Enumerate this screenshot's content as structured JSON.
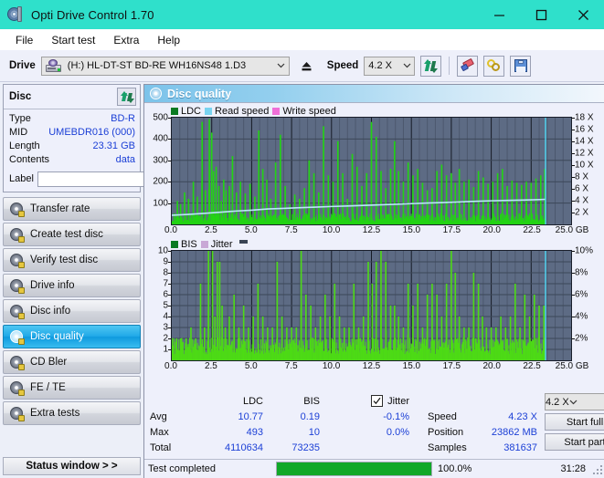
{
  "window": {
    "title": "Opti Drive Control 1.70",
    "icon": "disc-icon",
    "minimize": "–",
    "maximize": "□",
    "close": "✕"
  },
  "menu": {
    "items": [
      "File",
      "Start test",
      "Extra",
      "Help"
    ]
  },
  "toolbar": {
    "drive_label": "Drive",
    "drive_value": "(H:)   HL-DT-ST BD-RE  WH16NS48 1.D3",
    "eject_icon": "eject-icon",
    "speed_label": "Speed",
    "speed_value": "4.2 X",
    "refresh_icon": "refresh-icon",
    "eraser_icon": "eraser-icon",
    "chain_icon": "chain-icon",
    "save_icon": "save-icon"
  },
  "disc_panel": {
    "title": "Disc",
    "refresh_icon": "refresh-icon",
    "rows": [
      {
        "key": "Type",
        "value": "BD-R"
      },
      {
        "key": "MID",
        "value": "UMEBDR016 (000)"
      },
      {
        "key": "Length",
        "value": "23.31 GB"
      },
      {
        "key": "Contents",
        "value": "data"
      }
    ],
    "label_key": "Label",
    "label_value": "",
    "label_placeholder": "",
    "disc_icon": "yellow-disc-icon"
  },
  "nav": {
    "items": [
      {
        "label": "Transfer rate",
        "active": false
      },
      {
        "label": "Create test disc",
        "active": false
      },
      {
        "label": "Verify test disc",
        "active": false
      },
      {
        "label": "Drive info",
        "active": false
      },
      {
        "label": "Disc info",
        "active": false
      },
      {
        "label": "Disc quality",
        "active": true
      },
      {
        "label": "CD Bler",
        "active": false
      },
      {
        "label": "FE / TE",
        "active": false
      },
      {
        "label": "Extra tests",
        "active": false
      }
    ],
    "status_window": "Status window > >"
  },
  "content": {
    "title": "Disc quality",
    "icon": "disc-quality-icon"
  },
  "chart_data": [
    {
      "type": "bar",
      "name": "top-chart",
      "title": "",
      "legend": [
        {
          "label": "LDC",
          "color": "#0a7a22"
        },
        {
          "label": "Read speed",
          "color": "#79d3f0"
        },
        {
          "label": "Write speed",
          "color": "#f06fd8"
        }
      ],
      "legend_position": "top-left",
      "grid": true,
      "xlabel": "GB",
      "xlim": [
        0,
        25
      ],
      "xticks": [
        0.0,
        2.5,
        5.0,
        7.5,
        10.0,
        12.5,
        15.0,
        17.5,
        20.0,
        22.5,
        25.0
      ],
      "xticklabels": [
        "0.0",
        "2.5",
        "5.0",
        "7.5",
        "10.0",
        "12.5",
        "15.0",
        "17.5",
        "20.0",
        "22.5",
        "25.0 GB"
      ],
      "ylabel": "",
      "ylim": [
        0,
        500
      ],
      "yticks": [
        100,
        200,
        300,
        400,
        500
      ],
      "yticklabels": [
        "100",
        "200",
        "300",
        "400",
        "500"
      ],
      "y2lim": [
        0,
        18
      ],
      "y2ticks": [
        2,
        4,
        6,
        8,
        10,
        12,
        14,
        16,
        18
      ],
      "y2ticklabels": [
        "2 X",
        "4 X",
        "6 X",
        "8 X",
        "10 X",
        "12 X",
        "14 X",
        "16 X",
        "18 X"
      ],
      "plot_bg": "#5d6b84",
      "data_end_gb": 23.4,
      "series": [
        {
          "name": "LDC",
          "color": "#22d413",
          "baseline": 40,
          "peaks_x": [
            0.35,
            0.55,
            0.8,
            1.05,
            1.35,
            1.6,
            1.9,
            2.1,
            2.35,
            2.5,
            2.62,
            2.78,
            2.95,
            3.1,
            3.25,
            3.4,
            3.6,
            3.8,
            4.05,
            4.3,
            4.6,
            4.9,
            5.2,
            5.45,
            5.7,
            5.95,
            6.2,
            6.5,
            6.8,
            7.1,
            7.4,
            7.7,
            8.0,
            8.3,
            8.6,
            8.9,
            9.2,
            9.5,
            9.8,
            10.1,
            10.4,
            10.7,
            11.0,
            11.3,
            11.6,
            11.9,
            12.2,
            12.5,
            12.8,
            13.1,
            13.4,
            13.7,
            13.95,
            14.2,
            14.5,
            14.8,
            15.1,
            15.4,
            15.7,
            16.0,
            16.3,
            16.6,
            16.9,
            17.2,
            17.5,
            17.75,
            18.0,
            18.3,
            18.6,
            18.9,
            19.2,
            19.5,
            19.8,
            20.1,
            20.4,
            20.7,
            21.0,
            21.3,
            21.6,
            21.9,
            22.2,
            22.5,
            22.8,
            23.1,
            23.35
          ],
          "peaks_y": [
            110,
            95,
            150,
            120,
            200,
            130,
            480,
            160,
            493,
            430,
            250,
            270,
            180,
            110,
            210,
            160,
            180,
            320,
            150,
            200,
            145,
            190,
            130,
            440,
            260,
            210,
            120,
            290,
            420,
            180,
            95,
            140,
            120,
            170,
            300,
            240,
            150,
            460,
            230,
            200,
            390,
            240,
            120,
            330,
            270,
            180,
            240,
            480,
            410,
            250,
            170,
            260,
            390,
            250,
            200,
            290,
            230,
            260,
            195,
            160,
            170,
            250,
            280,
            230,
            240,
            195,
            260,
            200,
            210,
            175,
            250,
            220,
            190,
            200,
            240,
            260,
            180,
            205,
            195,
            185,
            200,
            195,
            215,
            230,
            260
          ]
        },
        {
          "name": "Read speed",
          "color": "#b8e8f8",
          "type": "line",
          "x": [
            0.0,
            1.0,
            2.0,
            3.0,
            4.0,
            5.0,
            6.0,
            7.0,
            8.0,
            9.0,
            10.0,
            11.0,
            12.0,
            13.0,
            14.0,
            15.0,
            16.0,
            17.0,
            18.0,
            19.0,
            20.0,
            21.0,
            22.0,
            23.0,
            23.4
          ],
          "y_speed": [
            1.55,
            1.68,
            1.85,
            2.05,
            2.25,
            2.4,
            2.6,
            2.7,
            2.82,
            2.92,
            3.02,
            3.1,
            3.2,
            3.3,
            3.4,
            3.5,
            3.6,
            3.68,
            3.78,
            3.9,
            3.98,
            4.05,
            4.1,
            4.18,
            4.23
          ]
        },
        {
          "name": "Write speed",
          "color": "#f06fd8",
          "x": [],
          "y": []
        }
      ],
      "cursor_x_gb": 23.4,
      "cursor_color": "#4fd8f5"
    },
    {
      "type": "bar",
      "name": "bottom-chart",
      "title": "",
      "legend": [
        {
          "label": "BIS",
          "color": "#0a7a22"
        },
        {
          "label": "Jitter",
          "color": "#c9a8d6"
        }
      ],
      "legend_position": "top-left",
      "grid": true,
      "xlabel": "GB",
      "xlim": [
        0,
        25
      ],
      "xticks": [
        0.0,
        2.5,
        5.0,
        7.5,
        10.0,
        12.5,
        15.0,
        17.5,
        20.0,
        22.5,
        25.0
      ],
      "xticklabels": [
        "0.0",
        "2.5",
        "5.0",
        "7.5",
        "10.0",
        "12.5",
        "15.0",
        "17.5",
        "20.0",
        "22.5",
        "25.0 GB"
      ],
      "ylim": [
        0,
        10
      ],
      "yticks": [
        1,
        2,
        3,
        4,
        5,
        6,
        7,
        8,
        9,
        10
      ],
      "yticklabels": [
        "1",
        "2",
        "3",
        "4",
        "5",
        "6",
        "7",
        "8",
        "9",
        "10"
      ],
      "y2lim": [
        0,
        10
      ],
      "y2ticks": [
        2,
        4,
        6,
        8,
        10
      ],
      "y2ticklabels": [
        "2%",
        "4%",
        "6%",
        "8%",
        "10%"
      ],
      "plot_bg": "#5d6b84",
      "data_end_gb": 23.4,
      "series": [
        {
          "name": "BIS",
          "color": "#4ddb15",
          "baseline": 1.6,
          "peaks_x": [
            0.3,
            0.6,
            0.9,
            1.2,
            1.5,
            1.8,
            2.05,
            2.3,
            2.55,
            2.7,
            2.85,
            3.0,
            3.15,
            3.35,
            3.6,
            3.9,
            4.2,
            4.5,
            4.8,
            5.1,
            5.4,
            5.7,
            6.0,
            6.3,
            6.6,
            6.9,
            7.2,
            7.5,
            7.8,
            8.1,
            8.4,
            8.7,
            9.0,
            9.3,
            9.6,
            9.9,
            10.2,
            10.5,
            10.8,
            11.1,
            11.4,
            11.7,
            12.0,
            12.3,
            12.55,
            12.8,
            13.1,
            13.4,
            13.7,
            13.95,
            14.2,
            14.5,
            14.8,
            15.1,
            15.4,
            15.7,
            16.0,
            16.3,
            16.6,
            16.9,
            17.2,
            17.5,
            17.75,
            18.0,
            18.3,
            18.6,
            18.9,
            19.2,
            19.45,
            19.7,
            20.0,
            20.3,
            20.6,
            20.9,
            21.2,
            21.5,
            21.8,
            22.1,
            22.4,
            22.7,
            23.0,
            23.3
          ],
          "peaks_y": [
            2,
            2,
            2,
            3,
            2,
            7,
            3,
            10,
            10,
            4,
            9,
            9,
            5,
            3,
            4,
            6,
            3,
            5,
            3,
            4,
            7,
            4,
            3,
            3,
            9,
            4,
            3,
            3,
            3,
            10,
            6,
            5,
            3,
            4,
            6,
            4,
            7,
            4,
            3,
            3,
            7,
            3,
            4,
            9,
            7,
            9,
            10,
            9,
            5,
            5,
            4,
            3,
            7,
            5,
            7,
            3,
            6,
            7,
            6,
            4,
            7,
            10,
            8,
            4,
            3,
            3,
            8,
            7,
            4,
            3,
            3,
            3,
            4,
            3,
            4,
            7,
            3,
            6,
            4,
            6,
            5,
            5
          ]
        },
        {
          "name": "Jitter",
          "color": "#c9a8d6",
          "x": [],
          "y": []
        }
      ],
      "cursor_x_gb": 23.4,
      "cursor_color": "#4fd8f5"
    }
  ],
  "stats": {
    "col_headers": [
      "LDC",
      "BIS"
    ],
    "jitter_label": "Jitter",
    "jitter_checked": true,
    "rows": [
      {
        "label": "Avg",
        "ldc": "10.77",
        "bis": "0.19",
        "jitter": "-0.1%"
      },
      {
        "label": "Max",
        "ldc": "493",
        "bis": "10",
        "jitter": "0.0%"
      },
      {
        "label": "Total",
        "ldc": "4110634",
        "bis": "73235",
        "jitter": ""
      }
    ],
    "right": [
      {
        "key": "Speed",
        "value": "4.23 X"
      },
      {
        "key": "Position",
        "value": "23862 MB"
      },
      {
        "key": "Samples",
        "value": "381637"
      }
    ],
    "speed_select": "4.2 X",
    "start_full": "Start full",
    "start_part": "Start part"
  },
  "statusbar": {
    "text": "Test completed",
    "progress_percent": 100.0,
    "progress_label": "100.0%",
    "elapsed": "31:28"
  }
}
